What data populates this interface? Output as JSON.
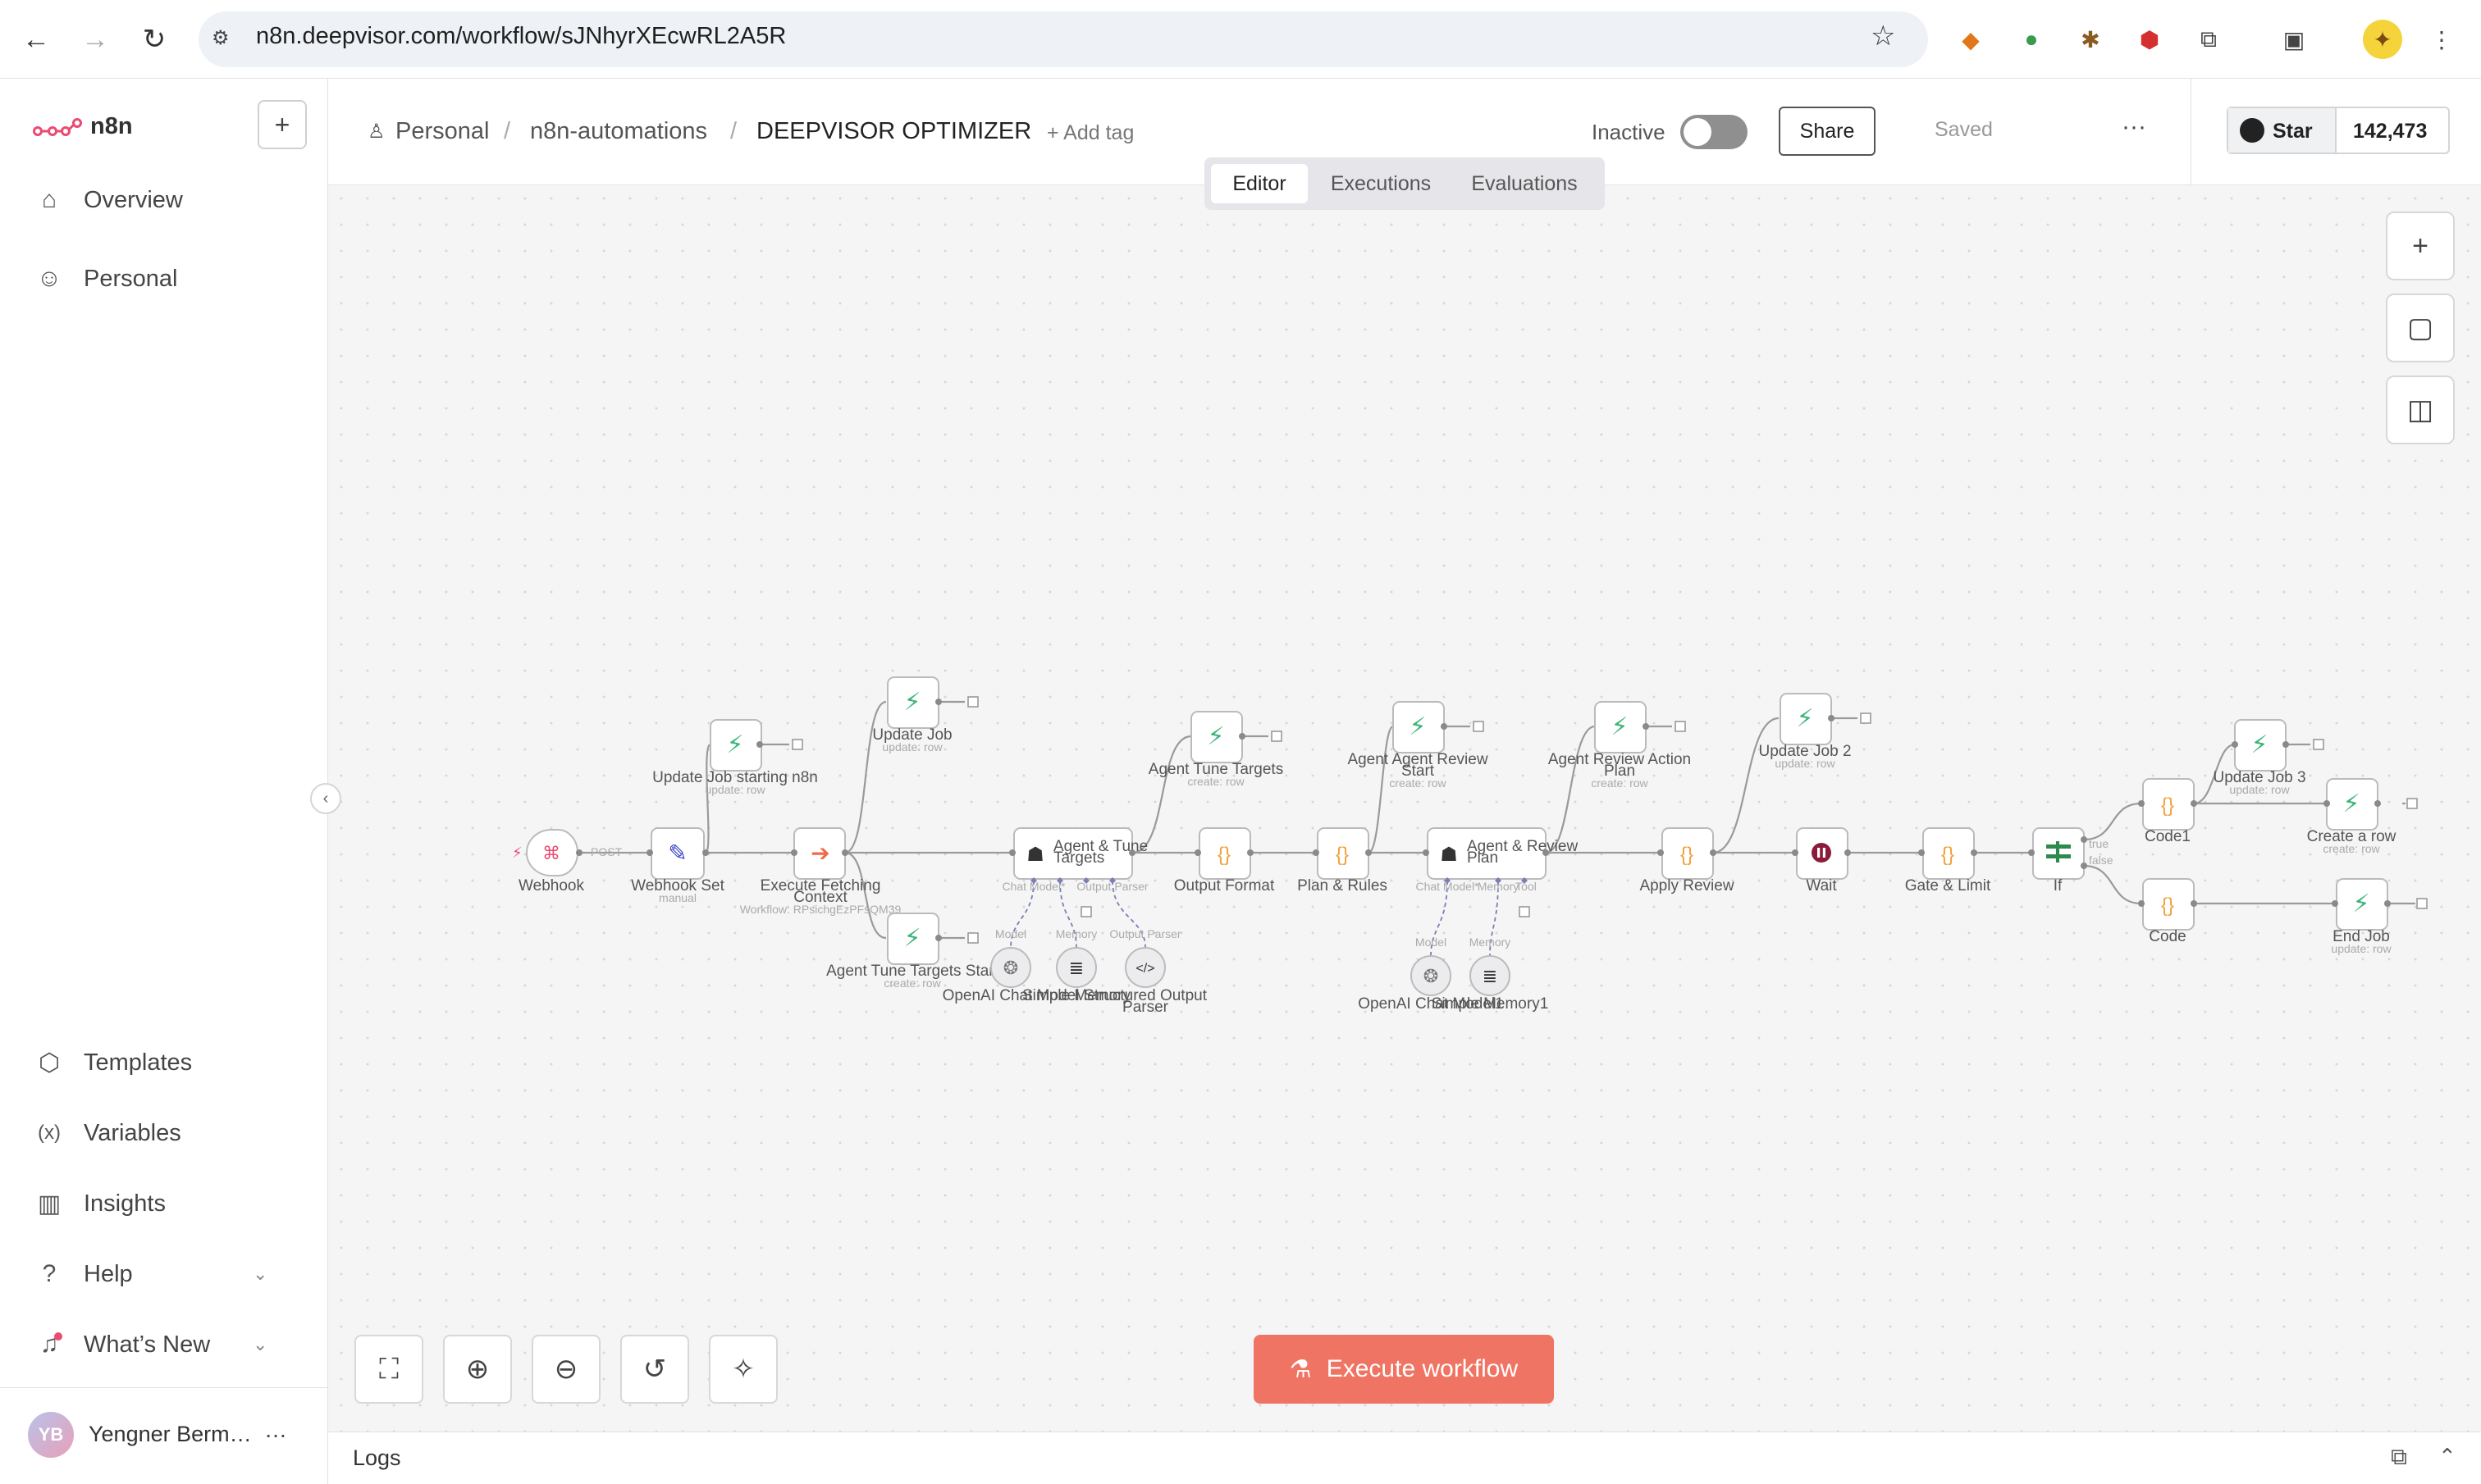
{
  "browser": {
    "url": "n8n.deepvisor.com/workflow/sJNhyrXEcwRL2A5R"
  },
  "sidebar": {
    "logo_text": "n8n",
    "add_label": "+",
    "items": [
      {
        "label": "Overview",
        "icon": "home-icon"
      },
      {
        "label": "Personal",
        "icon": "user-icon"
      }
    ],
    "bottom_items": [
      {
        "label": "Templates",
        "icon": "templates-icon"
      },
      {
        "label": "Variables",
        "icon": "variables-icon"
      },
      {
        "label": "Insights",
        "icon": "insights-icon"
      },
      {
        "label": "Help",
        "icon": "help-icon"
      },
      {
        "label": "What’s New",
        "icon": "bell-icon"
      }
    ],
    "user": {
      "initials": "YB",
      "name": "Yengner Berm…",
      "more": "…"
    }
  },
  "header": {
    "breadcrumb": [
      "Personal",
      "n8n-automations",
      "DEEPVISOR OPTIMIZER"
    ],
    "separator": "/",
    "add_tag": "+ Add tag",
    "status_label": "Inactive",
    "share_label": "Share",
    "saved_label": "Saved",
    "more_label": "···",
    "github_star": "Star",
    "github_count": "142,473",
    "tabs": [
      "Editor",
      "Executions",
      "Evaluations"
    ]
  },
  "footer": {
    "execute_label": "Execute workflow",
    "logs_label": "Logs"
  },
  "colors": {
    "brand": "#ea4b71",
    "execute": "#f07463",
    "node_green": "#3fb57a",
    "node_orange": "#f0a23a"
  },
  "workflow": {
    "nodes": [
      {
        "label": "Webhook",
        "sub": "",
        "icon": "webhook-icon"
      },
      {
        "label": "Webhook Set",
        "sub": "manual",
        "icon": "edit-icon"
      },
      {
        "label": "Update Job starting n8n",
        "sub": "update: row",
        "icon": "supabase-icon"
      },
      {
        "label": "Execute Fetching Context",
        "sub": "Workflow: RPsichgEzPFsQM39",
        "icon": "execute-icon"
      },
      {
        "label": "Update Job",
        "sub": "update: row",
        "icon": "supabase-icon"
      },
      {
        "label": "Agent Tune Targets Start",
        "sub": "create: row",
        "icon": "supabase-icon"
      },
      {
        "label": "Agent & Tune Targets",
        "sub": "",
        "icon": "robot-icon"
      },
      {
        "label": "OpenAI Chat Model",
        "sub": "",
        "icon": "openai-icon"
      },
      {
        "label": "Simple Memory",
        "sub": "",
        "icon": "database-icon"
      },
      {
        "label": "Structured Output Parser",
        "sub": "",
        "icon": "code-icon"
      },
      {
        "label": "Agent Tune Targets",
        "sub": "create: row",
        "icon": "supabase-icon"
      },
      {
        "label": "Output Format",
        "sub": "",
        "icon": "braces-icon"
      },
      {
        "label": "Plan & Rules",
        "sub": "",
        "icon": "braces-icon"
      },
      {
        "label": "Agent Agent Review Start",
        "sub": "create: row",
        "icon": "supabase-icon"
      },
      {
        "label": "Agent & Review Plan",
        "sub": "",
        "icon": "robot-icon"
      },
      {
        "label": "OpenAI Chat Model1",
        "sub": "",
        "icon": "openai-icon"
      },
      {
        "label": "Simple Memory1",
        "sub": "",
        "icon": "database-icon"
      },
      {
        "label": "Agent Review Action Plan",
        "sub": "create: row",
        "icon": "supabase-icon"
      },
      {
        "label": "Apply Review",
        "sub": "",
        "icon": "braces-icon"
      },
      {
        "label": "Update Job 2",
        "sub": "update: row",
        "icon": "supabase-icon"
      },
      {
        "label": "Wait",
        "sub": "",
        "icon": "pause-icon"
      },
      {
        "label": "Gate & Limit",
        "sub": "",
        "icon": "braces-icon"
      },
      {
        "label": "If",
        "sub": "",
        "icon": "if-icon"
      },
      {
        "label": "Code1",
        "sub": "",
        "icon": "braces-icon"
      },
      {
        "label": "Update Job 3",
        "sub": "update: row",
        "icon": "supabase-icon"
      },
      {
        "label": "Create a row",
        "sub": "create: row",
        "icon": "supabase-icon"
      },
      {
        "label": "Code",
        "sub": "",
        "icon": "braces-icon"
      },
      {
        "label": "End Job",
        "sub": "update: row",
        "icon": "supabase-icon"
      }
    ],
    "port_labels": {
      "model": "Model",
      "memory": "Memory",
      "output_parser": "Output Parser",
      "chat_model": "Chat Model*",
      "tool": "Tool",
      "post": "POST",
      "true": "true",
      "false": "false"
    }
  }
}
